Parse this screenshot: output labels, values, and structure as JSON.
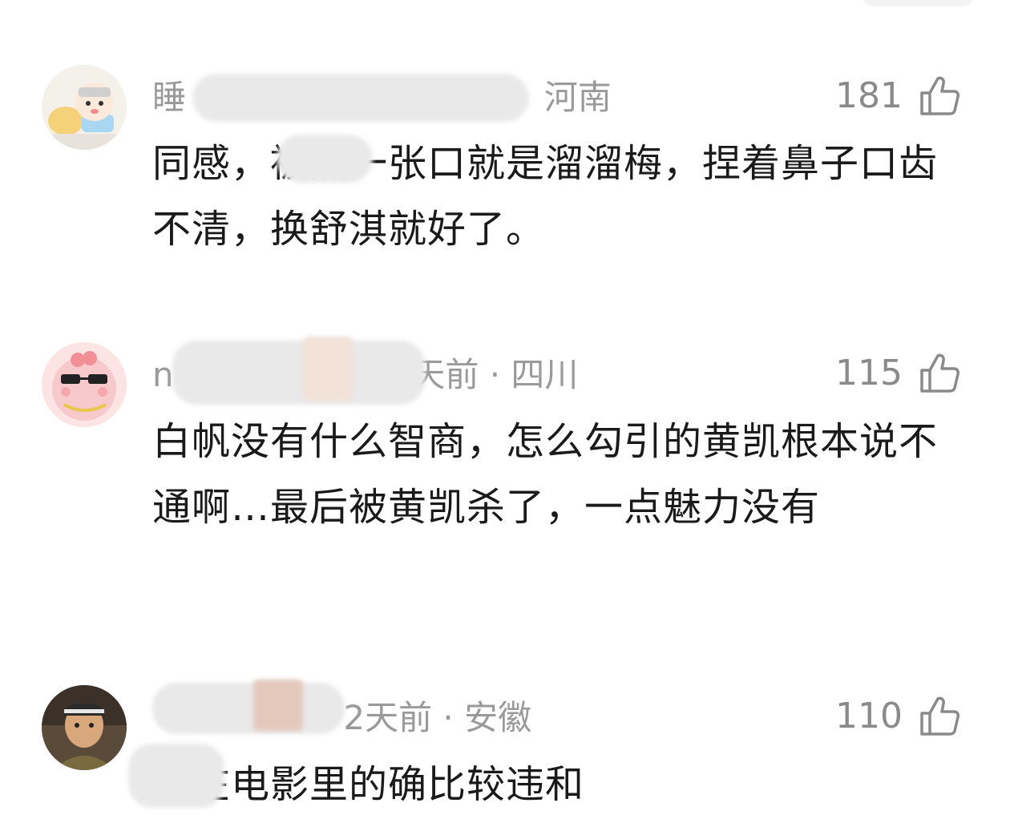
{
  "comments": [
    {
      "username": "睡",
      "time_location": "河南",
      "likes": "181",
      "text": "同感，被黑一张口就是溜溜梅，捏着鼻子口齿不清，换舒淇就好了。"
    },
    {
      "username": "n",
      "time_location": "天前 · 四川",
      "likes": "115",
      "text": "白帆没有什么智商，怎么勾引的黄凯根本说不通啊…最后被黄凯杀了，一点魅力没有"
    },
    {
      "username": "",
      "time_location": "2天前 · 安徽",
      "likes": "110",
      "text": "看在电影里的确比较违和"
    }
  ],
  "icons": {
    "like": "thumbs-up-icon"
  },
  "colors": {
    "meta_text": "#9a9a9a",
    "body_text": "#1a1a1a"
  }
}
